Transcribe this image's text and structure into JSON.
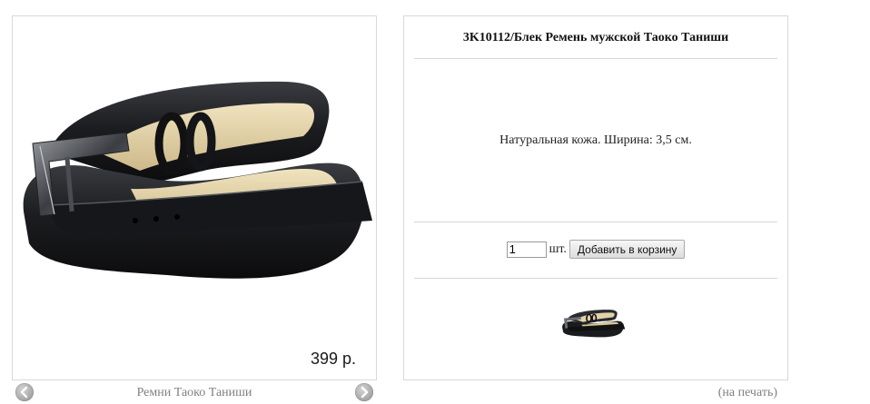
{
  "product": {
    "title": "3K10112/Блек Ремень мужской Таоко Таниши",
    "description": "Натуральная кожа. Ширина: 3,5 см.",
    "price": "399 р."
  },
  "order": {
    "quantity": "1",
    "unit": "шт.",
    "add_to_cart_label": "Добавить в корзину"
  },
  "navigation": {
    "category": "Ремни Таоко Таниши",
    "prev_icon": "chevron-left-icon",
    "next_icon": "chevron-right-icon"
  },
  "print_label": "(на печать)",
  "colors": {
    "panel_border": "#d9d9d9",
    "muted_text": "#808080",
    "belt": "#1e1f22",
    "belt_lining": "#e2d2a8"
  }
}
